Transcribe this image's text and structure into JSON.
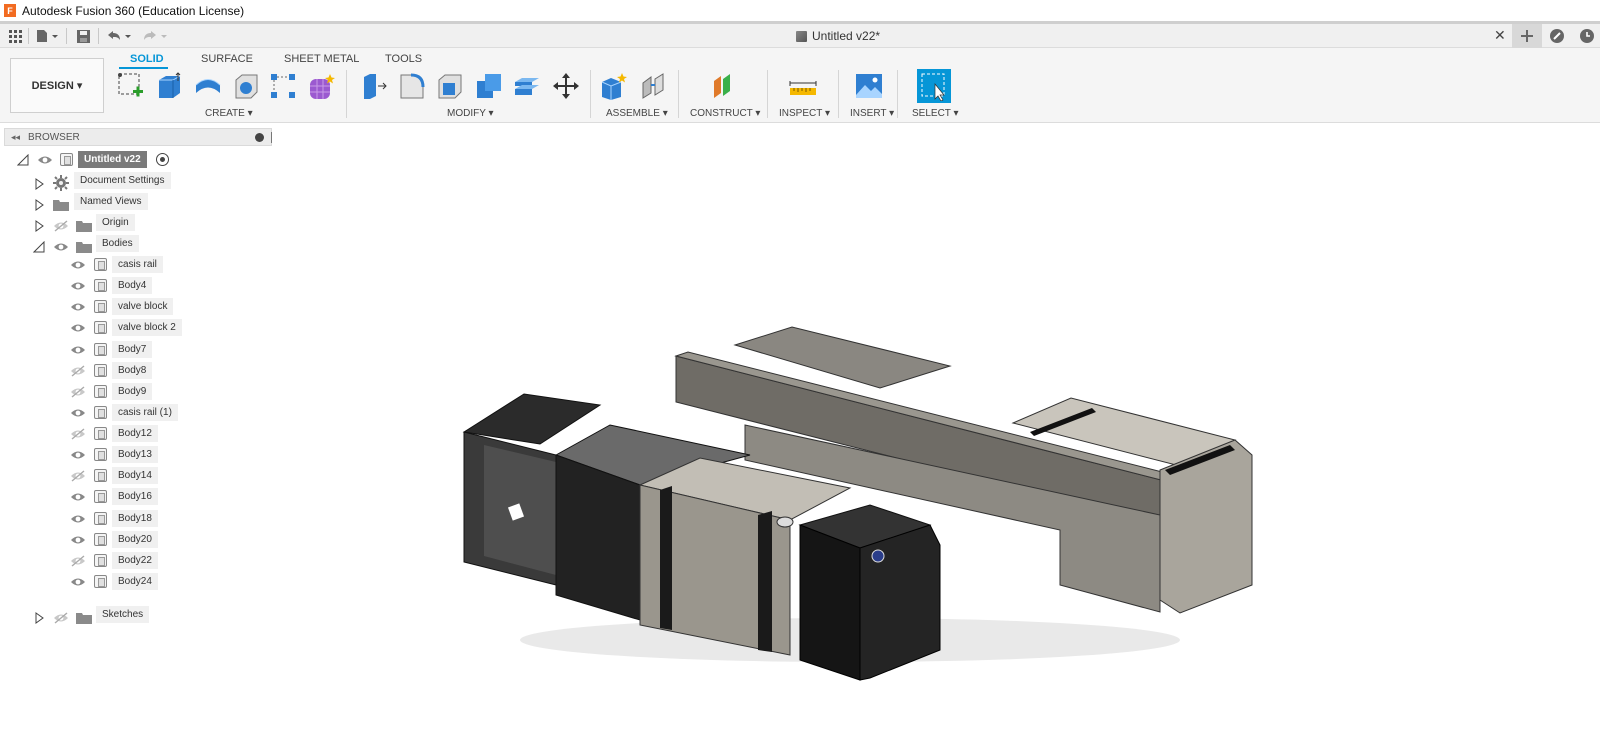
{
  "window": {
    "title": "Autodesk Fusion 360 (Education License)",
    "logo_letter": "F"
  },
  "document": {
    "tab_title": "Untitled v22*",
    "close_glyph": "✕"
  },
  "qat": {
    "icons": [
      "grid-icon",
      "file-icon",
      "save-icon",
      "undo-icon",
      "redo-icon"
    ]
  },
  "right_icons": [
    "plus-icon",
    "job-status-icon",
    "clock-icon"
  ],
  "workspace": {
    "label": "DESIGN ▾"
  },
  "ribbon": {
    "tabs": [
      "SOLID",
      "SURFACE",
      "SHEET METAL",
      "TOOLS"
    ],
    "active_tab": "SOLID",
    "groups": {
      "create": "CREATE ▾",
      "modify": "MODIFY ▾",
      "assemble": "ASSEMBLE ▾",
      "construct": "CONSTRUCT ▾",
      "inspect": "INSPECT ▾",
      "insert": "INSERT ▾",
      "select": "SELECT ▾"
    },
    "accent": "#0696d7"
  },
  "browser": {
    "title": "BROWSER",
    "root": "Untitled v22",
    "folders": {
      "document_settings": "Document Settings",
      "named_views": "Named Views",
      "origin": "Origin",
      "bodies": "Bodies",
      "sketches": "Sketches"
    },
    "bodies": [
      {
        "name": "casis rail",
        "visible": true
      },
      {
        "name": "Body4",
        "visible": true
      },
      {
        "name": "valve block",
        "visible": true
      },
      {
        "name": "valve block 2",
        "visible": true
      },
      {
        "name": "Body7",
        "visible": true
      },
      {
        "name": "Body8",
        "visible": false
      },
      {
        "name": "Body9",
        "visible": false
      },
      {
        "name": "casis rail (1)",
        "visible": true
      },
      {
        "name": "Body12",
        "visible": false
      },
      {
        "name": "Body13",
        "visible": true
      },
      {
        "name": "Body14",
        "visible": false
      },
      {
        "name": "Body16",
        "visible": true
      },
      {
        "name": "Body18",
        "visible": true
      },
      {
        "name": "Body20",
        "visible": true
      },
      {
        "name": "Body22",
        "visible": false
      },
      {
        "name": "Body24",
        "visible": true
      }
    ]
  }
}
